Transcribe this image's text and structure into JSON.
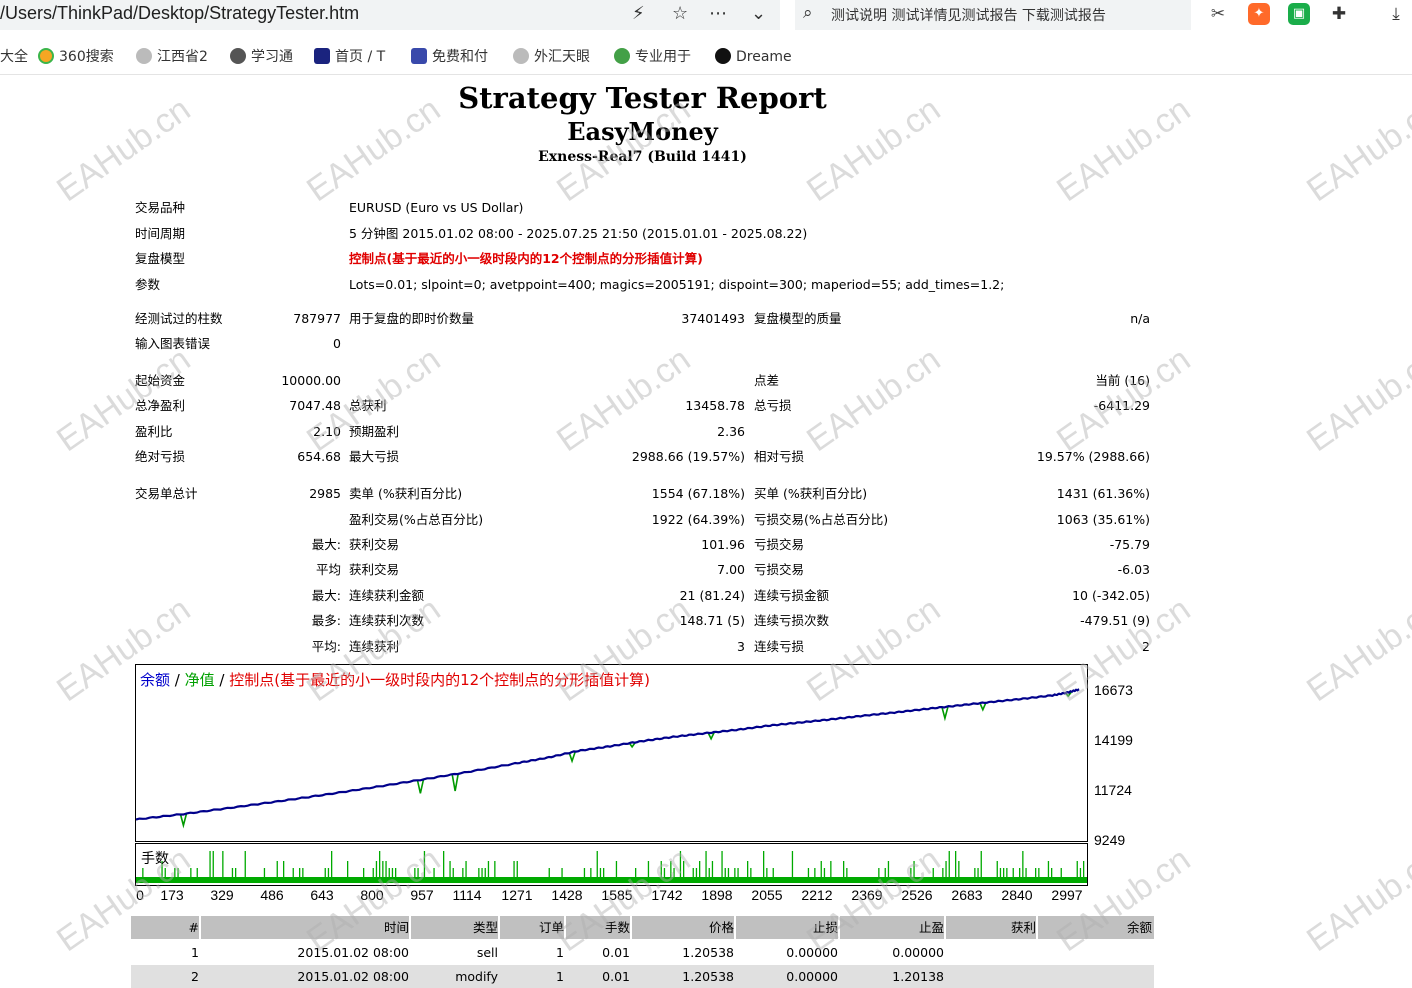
{
  "browser": {
    "url": "/Users/ThinkPad/Desktop/StrategyTester.htm",
    "search_text": "测试说明 测试详情见测试报告 下载测试报告",
    "bookmarks": [
      "大全",
      "360搜索",
      "江西省2",
      "学习通",
      "首页 / T",
      "免费和付",
      "外汇天眼",
      "专业用于",
      "Dreame"
    ]
  },
  "report": {
    "title": "Strategy Tester Report",
    "ea_name": "EasyMoney",
    "server": "Exness-Real7 (Build 1441)"
  },
  "info": {
    "symbol_label": "交易品种",
    "symbol_value": "EURUSD (Euro vs US Dollar)",
    "period_label": "时间周期",
    "period_value": "5 分钟图 2015.01.02 08:00 - 2025.07.25 21:50 (2015.01.01 - 2025.08.22)",
    "model_label": "复盘模型",
    "model_value": "控制点(基于最近的小一级时段内的12个控制点的分形插值计算)",
    "params_label": "参数",
    "params_value": "Lots=0.01; slpoint=0; avetppoint=400; magics=2005191; dispoint=300; maperiod=55; add_times=1.2;"
  },
  "stats": {
    "bars_label": "经测试过的柱数",
    "bars_value": "787977",
    "ticks_label": "用于复盘的即时价数量",
    "ticks_value": "37401493",
    "quality_label": "复盘模型的质量",
    "quality_value": "n/a",
    "errors_label": "输入图表错误",
    "errors_value": "0",
    "deposit_label": "起始资金",
    "deposit_value": "10000.00",
    "spread_label": "点差",
    "spread_value": "当前 (16)",
    "net_label": "总净盈利",
    "net_value": "7047.48",
    "gross_profit_label": "总获利",
    "gross_profit_value": "13458.78",
    "gross_loss_label": "总亏损",
    "gross_loss_value": "-6411.29",
    "pf_label": "盈利比",
    "pf_value": "2.10",
    "expected_label": "预期盈利",
    "expected_value": "2.36",
    "abs_dd_label": "绝对亏损",
    "abs_dd_value": "654.68",
    "max_dd_label": "最大亏损",
    "max_dd_value": "2988.66 (19.57%)",
    "rel_dd_label": "相对亏损",
    "rel_dd_value": "19.57% (2988.66)",
    "total_trades_label": "交易单总计",
    "total_trades_value": "2985",
    "short_label": "卖单 (%获利百分比)",
    "short_value": "1554 (67.18%)",
    "long_label": "买单 (%获利百分比)",
    "long_value": "1431 (61.36%)",
    "profit_trades_label": "盈利交易(%占总百分比)",
    "profit_trades_value": "1922 (64.39%)",
    "loss_trades_label": "亏损交易(%占总百分比)",
    "loss_trades_value": "1063 (35.61%)",
    "largest_label": "最大:",
    "largest_profit_label": "获利交易",
    "largest_profit_value": "101.96",
    "largest_loss_label": "亏损交易",
    "largest_loss_value": "-75.79",
    "average_label": "平均",
    "average_profit_label": "获利交易",
    "average_profit_value": "7.00",
    "average_loss_label": "亏损交易",
    "average_loss_value": "-6.03",
    "max_cons_label": "最大:",
    "max_cons_win_label": "连续获利金额",
    "max_cons_win_value": "21 (81.24)",
    "max_cons_loss_label": "连续亏损金额",
    "max_cons_loss_value": "10 (-342.05)",
    "most_label": "最多:",
    "most_win_label": "连续获利次数",
    "most_win_value": "148.71 (5)",
    "most_loss_label": "连续亏损次数",
    "most_loss_value": "-479.51 (9)",
    "avg_cons_label": "平均:",
    "avg_cons_win_label": "连续获利",
    "avg_cons_win_value": "3",
    "avg_cons_loss_label": "连续亏损",
    "avg_cons_loss_value": "2"
  },
  "chart_data": {
    "type": "line",
    "legend": {
      "balance": "余额",
      "sep1": " / ",
      "equity": "净值",
      "sep2": " / ",
      "model": "控制点(基于最近的小一级时段内的12个控制点的分形插值计算)"
    },
    "volume_label": "手数",
    "y_ticks": [
      "16673",
      "14199",
      "11724",
      "9249"
    ],
    "x_ticks": [
      "0",
      "173",
      "329",
      "486",
      "643",
      "800",
      "957",
      "1114",
      "1271",
      "1428",
      "1585",
      "1742",
      "1898",
      "2055",
      "2212",
      "2369",
      "2526",
      "2683",
      "2840",
      "2997"
    ],
    "ylim": [
      9249,
      16673
    ],
    "xlim": [
      0,
      2997
    ],
    "series": [
      {
        "name": "余额",
        "color": "#00008b",
        "x": [
          0,
          150,
          300,
          450,
          600,
          750,
          900,
          1050,
          1200,
          1300,
          1400,
          1500,
          1600,
          1700,
          1800,
          1900,
          2000,
          2100,
          2200,
          2300,
          2400,
          2500,
          2600,
          2700,
          2800,
          2900,
          2950,
          2985
        ],
        "y": [
          9860,
          10150,
          10480,
          10820,
          11180,
          11560,
          11960,
          12380,
          12830,
          13130,
          13500,
          13740,
          14010,
          14240,
          14430,
          14610,
          14830,
          15000,
          15170,
          15360,
          15530,
          15720,
          15900,
          16080,
          16250,
          16440,
          16600,
          16760
        ]
      },
      {
        "name": "净值",
        "color": "#009900",
        "dips": [
          [
            150,
            9550
          ],
          [
            900,
            11250
          ],
          [
            1010,
            11370
          ],
          [
            1380,
            12960
          ],
          [
            1570,
            13710
          ],
          [
            1820,
            14140
          ],
          [
            2560,
            15230
          ],
          [
            2680,
            15680
          ],
          [
            2950,
            16400
          ]
        ]
      }
    ],
    "volume_color": "#00aa00",
    "grid": false
  },
  "trades": {
    "headers": [
      "#",
      "时间",
      "类型",
      "订单",
      "手数",
      "价格",
      "止损",
      "止盈",
      "获利",
      "余额"
    ],
    "rows": [
      [
        "1",
        "2015.01.02 08:00",
        "sell",
        "1",
        "0.01",
        "1.20538",
        "0.00000",
        "0.00000",
        "",
        ""
      ],
      [
        "2",
        "2015.01.02 08:00",
        "modify",
        "1",
        "0.01",
        "1.20538",
        "0.00000",
        "1.20138",
        "",
        ""
      ]
    ]
  },
  "watermark": "EAHub.cn",
  "colors": {
    "model_text": "#e00000",
    "table_header": "#c0c0c0",
    "row_alt": "#e0e0e0"
  }
}
